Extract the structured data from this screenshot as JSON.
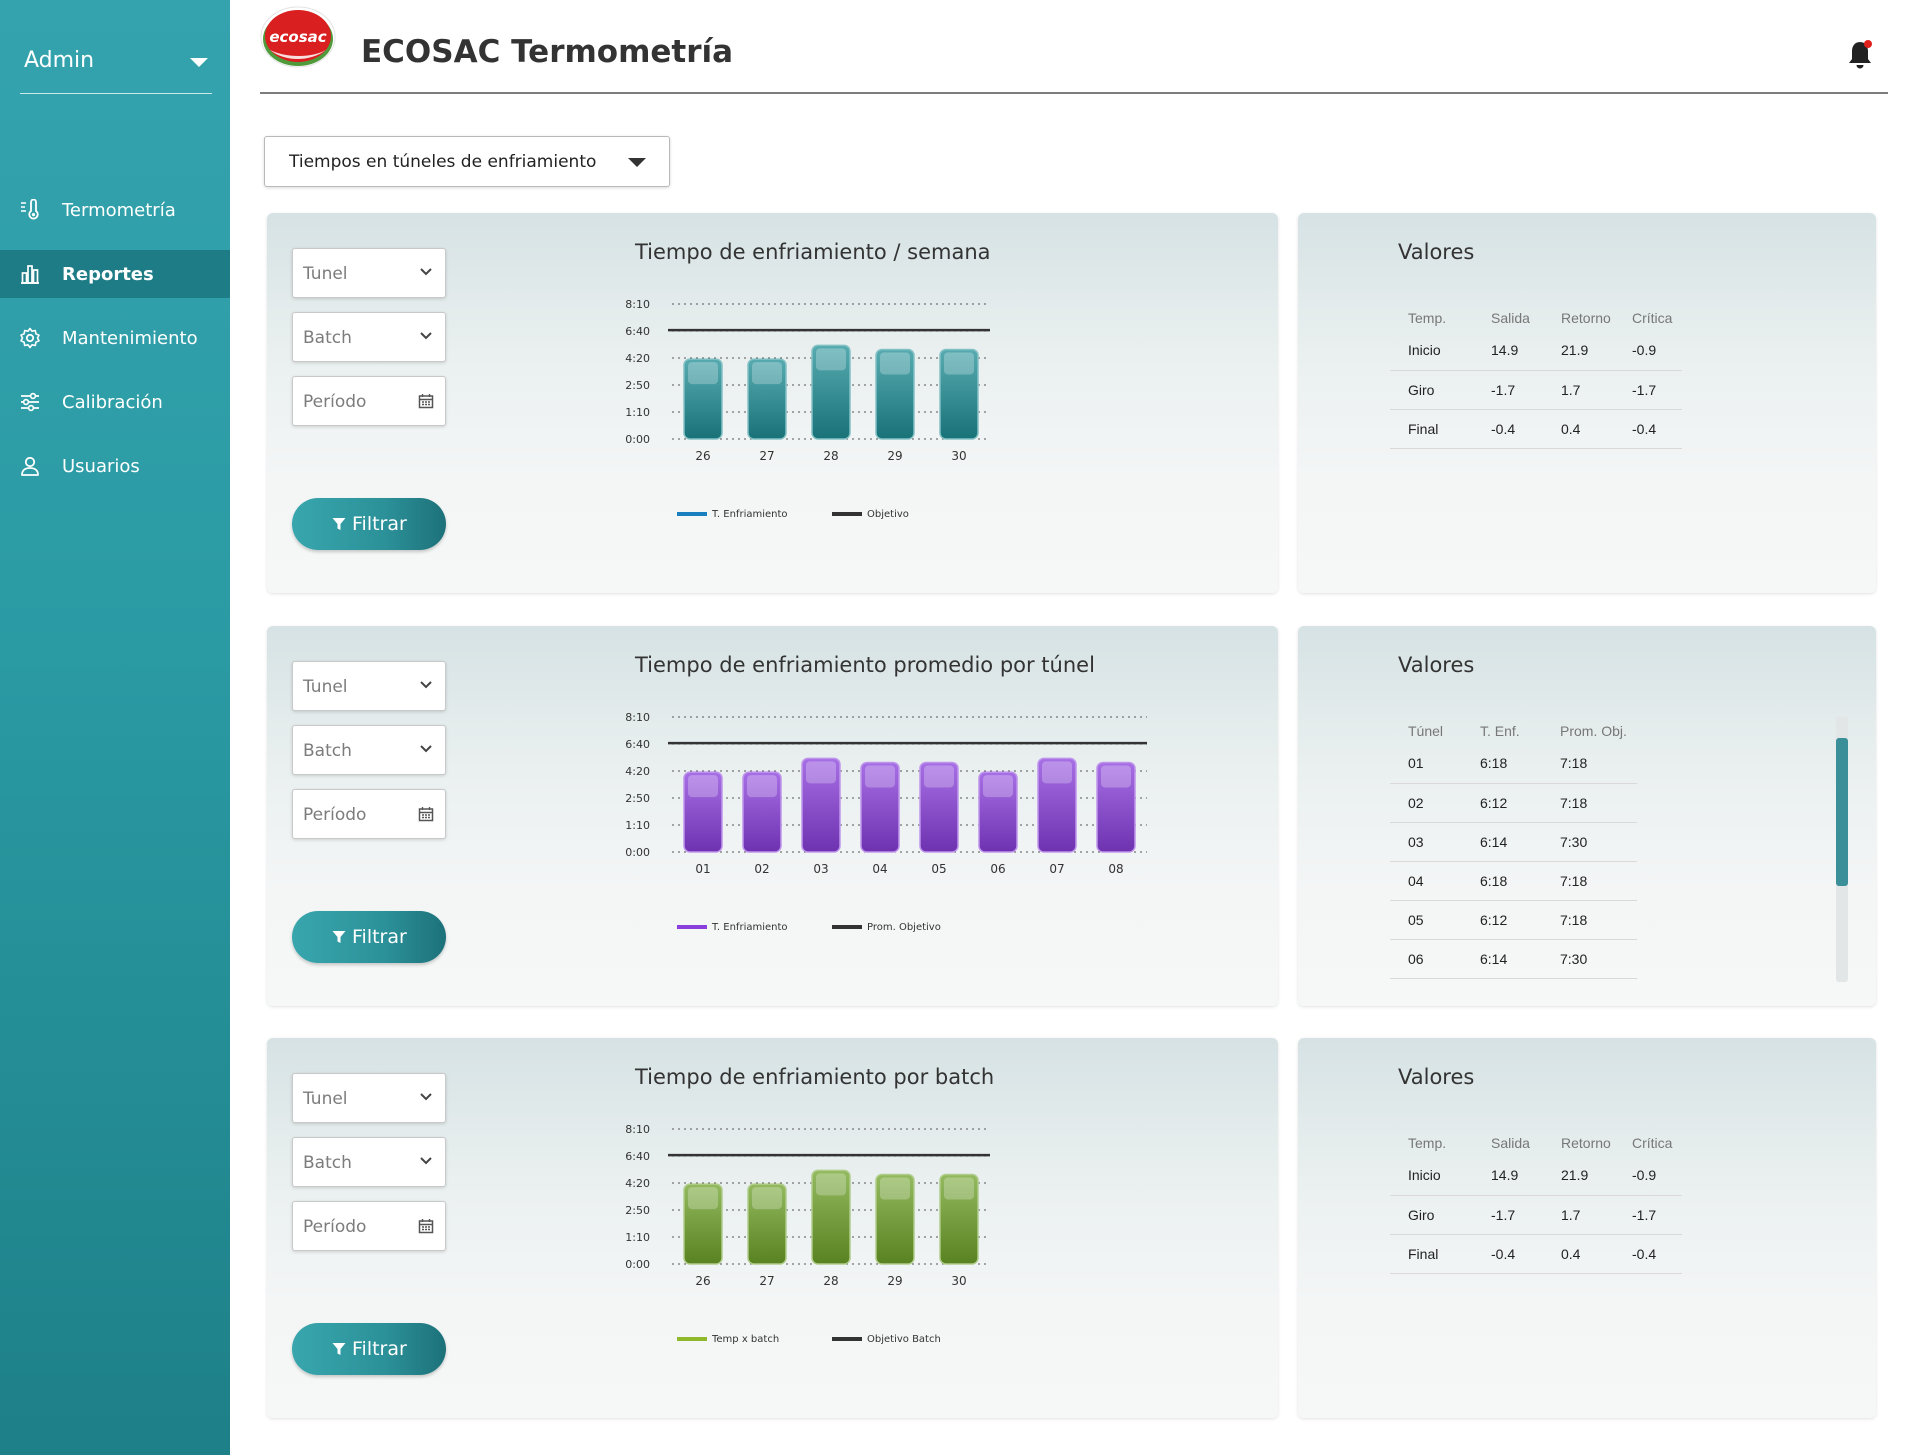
{
  "sidebar": {
    "user": "Admin",
    "items": [
      {
        "label": "Termometría",
        "icon": "thermometer-icon",
        "active": false
      },
      {
        "label": "Reportes",
        "icon": "bar-chart-icon",
        "active": true
      },
      {
        "label": "Mantenimiento",
        "icon": "gear-icon",
        "active": false
      },
      {
        "label": "Calibración",
        "icon": "sliders-icon",
        "active": false
      },
      {
        "label": "Usuarios",
        "icon": "user-icon",
        "active": false
      }
    ]
  },
  "header": {
    "logo_text": "ecosac",
    "title": "ECOSAC Termometría",
    "notification_dot_color": "#e0201b"
  },
  "report_selector": {
    "value": "Tiempos en túneles de enfriamiento"
  },
  "filters": {
    "tunel": "Tunel",
    "batch": "Batch",
    "periodo": "Período",
    "button": "Filtrar"
  },
  "colors": {
    "teal": "#1f8f96",
    "purple": "#8a3fdc",
    "green": "#6fa32a",
    "target": "#333333",
    "accent": "#2a9aa3"
  },
  "panels": [
    {
      "title": "Tiempo de enfriamiento / semana",
      "values_title": "Valores",
      "chart_data": {
        "type": "bar",
        "categories": [
          "26",
          "27",
          "28",
          "29",
          "30"
        ],
        "y_ticks": [
          "8:10",
          "6:40",
          "4:20",
          "2:50",
          "1:10",
          "0:00"
        ],
        "ylim_minutes": [
          0,
          490
        ],
        "series": [
          {
            "name": "T. Enfriamiento",
            "color": "#1f8f96",
            "values_minutes": [
              290,
              290,
              340,
              325,
              325
            ]
          },
          {
            "name": "Objetivo",
            "type": "line",
            "color": "#333333",
            "value_minutes": 395
          }
        ],
        "legend": [
          {
            "label": "T. Enfriamiento",
            "color": "#1a7fbf"
          },
          {
            "label": "Objetivo",
            "color": "#333333"
          }
        ]
      },
      "table": {
        "headers": [
          "Temp.",
          "Salida",
          "Retorno",
          "Crítica"
        ],
        "rows": [
          [
            "Inicio",
            "14.9",
            "21.9",
            "-0.9"
          ],
          [
            "Giro",
            "-1.7",
            "1.7",
            "-1.7"
          ],
          [
            "Final",
            "-0.4",
            "0.4",
            "-0.4"
          ]
        ]
      }
    },
    {
      "title": "Tiempo de enfriamiento promedio por túnel",
      "values_title": "Valores",
      "chart_data": {
        "type": "bar",
        "categories": [
          "01",
          "02",
          "03",
          "04",
          "05",
          "06",
          "07",
          "08"
        ],
        "y_ticks": [
          "8:10",
          "6:40",
          "4:20",
          "2:50",
          "1:10",
          "0:00"
        ],
        "ylim_minutes": [
          0,
          490
        ],
        "series": [
          {
            "name": "T. Enfriamiento",
            "color": "#8a3fdc",
            "values_minutes": [
              290,
              290,
              340,
              325,
              325,
              290,
              340,
              325
            ]
          },
          {
            "name": "Prom. Objetivo",
            "type": "line",
            "color": "#333333",
            "value_minutes": 395
          }
        ],
        "legend": [
          {
            "label": "T. Enfriamiento",
            "color": "#8a3fdc"
          },
          {
            "label": "Prom. Objetivo",
            "color": "#333333"
          }
        ]
      },
      "table": {
        "headers": [
          "Túnel",
          "T. Enf.",
          "Prom. Obj."
        ],
        "rows": [
          [
            "01",
            "6:18",
            "7:18"
          ],
          [
            "02",
            "6:12",
            "7:18"
          ],
          [
            "03",
            "6:14",
            "7:30"
          ],
          [
            "04",
            "6:18",
            "7:18"
          ],
          [
            "05",
            "6:12",
            "7:18"
          ],
          [
            "06",
            "6:14",
            "7:30"
          ]
        ]
      }
    },
    {
      "title": "Tiempo de enfriamiento por batch",
      "values_title": "Valores",
      "chart_data": {
        "type": "bar",
        "categories": [
          "26",
          "27",
          "28",
          "29",
          "30"
        ],
        "y_ticks": [
          "8:10",
          "6:40",
          "4:20",
          "2:50",
          "1:10",
          "0:00"
        ],
        "ylim_minutes": [
          0,
          490
        ],
        "series": [
          {
            "name": "Temp x batch",
            "color": "#6fa32a",
            "values_minutes": [
              290,
              290,
              340,
              325,
              325
            ]
          },
          {
            "name": "Objetivo Batch",
            "type": "line",
            "color": "#333333",
            "value_minutes": 395
          }
        ],
        "legend": [
          {
            "label": "Temp x batch",
            "color": "#8fb82a"
          },
          {
            "label": "Objetivo Batch",
            "color": "#333333"
          }
        ]
      },
      "table": {
        "headers": [
          "Temp.",
          "Salida",
          "Retorno",
          "Crítica"
        ],
        "rows": [
          [
            "Inicio",
            "14.9",
            "21.9",
            "-0.9"
          ],
          [
            "Giro",
            "-1.7",
            "1.7",
            "-1.7"
          ],
          [
            "Final",
            "-0.4",
            "0.4",
            "-0.4"
          ]
        ]
      }
    }
  ]
}
